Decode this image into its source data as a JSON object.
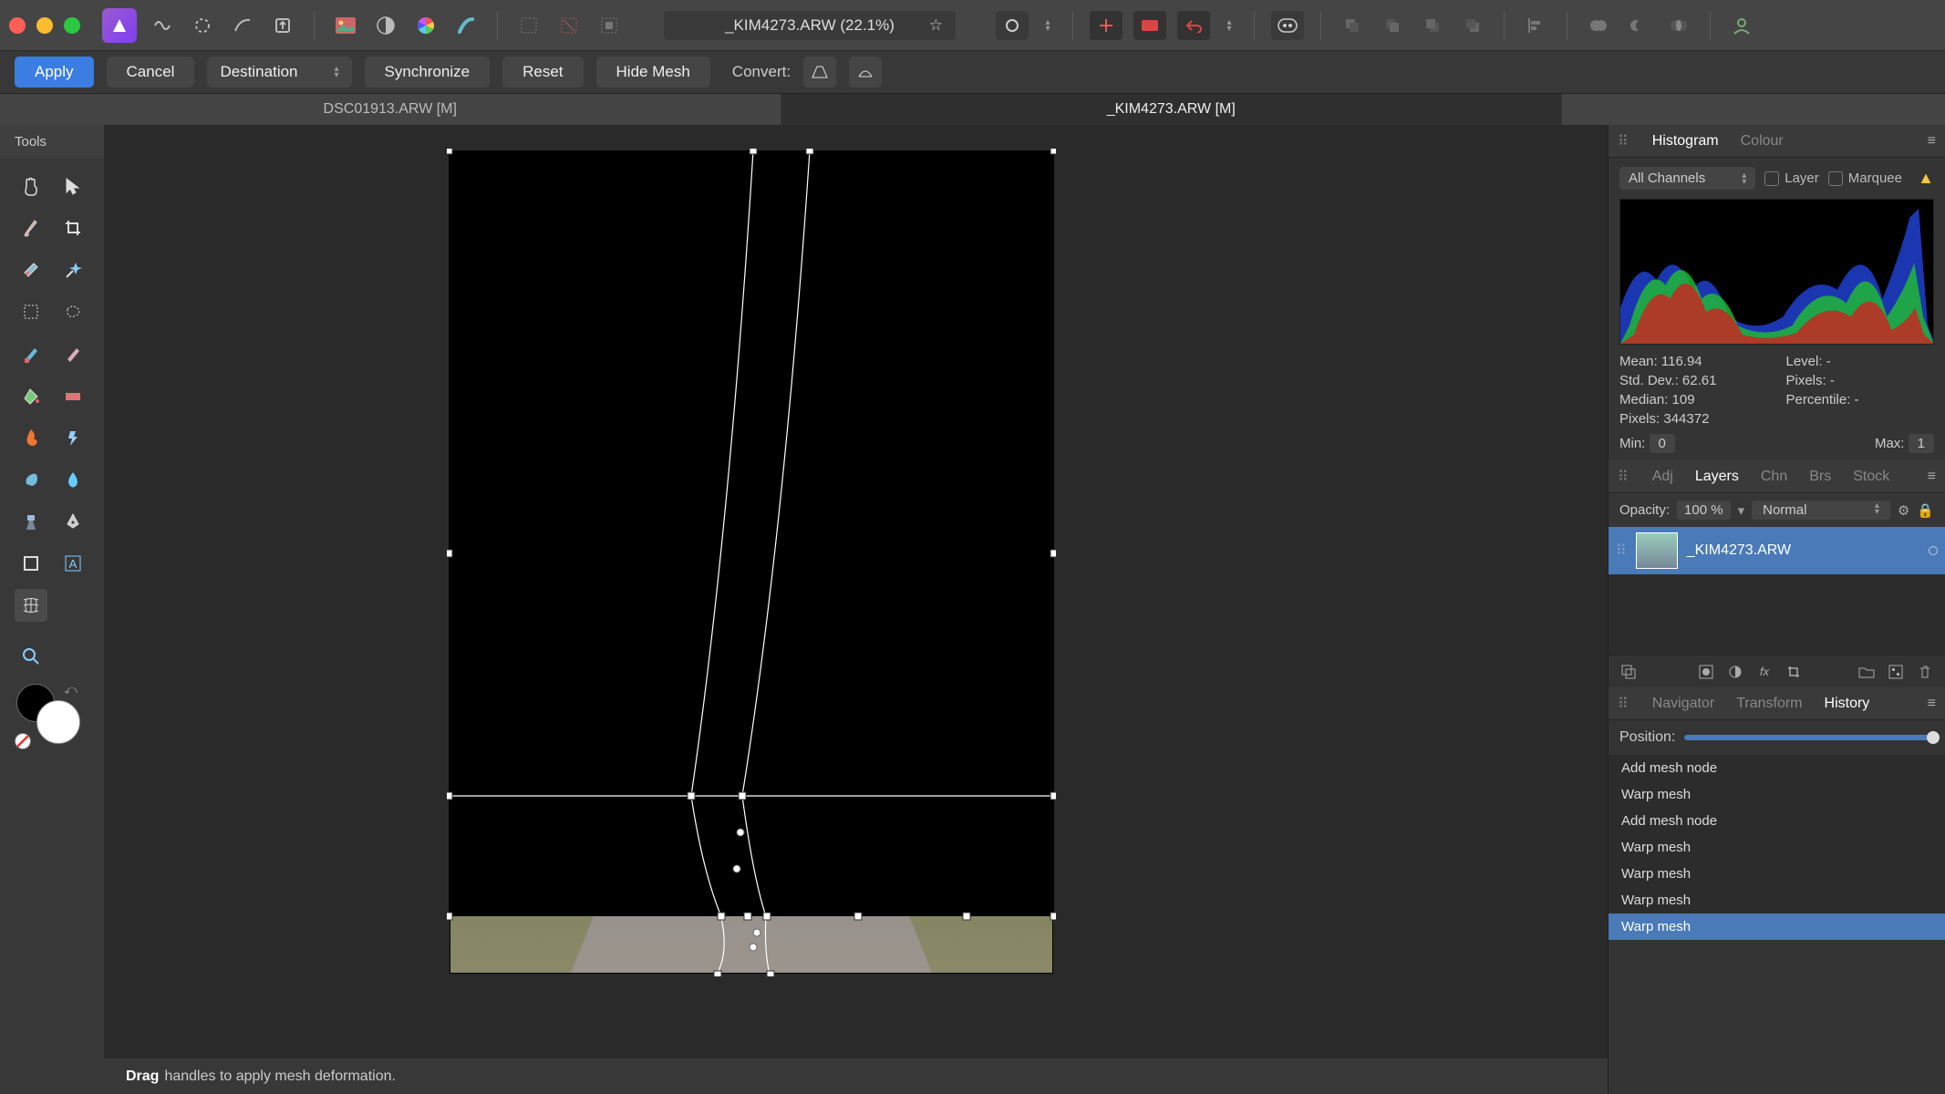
{
  "app": {
    "doc_title": "_KIM4273.ARW (22.1%)"
  },
  "context_bar": {
    "apply": "Apply",
    "cancel": "Cancel",
    "mode_select": "Destination",
    "synchronize": "Synchronize",
    "reset": "Reset",
    "hide_mesh": "Hide Mesh",
    "convert_label": "Convert:"
  },
  "doc_tabs": {
    "t0": "DSC01913.ARW [M]",
    "t1": "_KIM4273.ARW [M]"
  },
  "tools": {
    "title": "Tools"
  },
  "status": {
    "bold": "Drag",
    "rest": "handles to apply mesh deformation."
  },
  "histogram_panel": {
    "tab_hist": "Histogram",
    "tab_colour": "Colour",
    "channels": "All Channels",
    "chk_layer": "Layer",
    "chk_marquee": "Marquee",
    "mean_label": "Mean:",
    "mean_val": "116.94",
    "std_label": "Std. Dev.:",
    "std_val": "62.61",
    "median_label": "Median:",
    "median_val": "109",
    "pixels_label": "Pixels:",
    "pixels_val": "344372",
    "level_label": "Level:",
    "level_val": "-",
    "pixr_label": "Pixels:",
    "pixr_val": "-",
    "perc_label": "Percentile:",
    "perc_val": "-",
    "min_label": "Min:",
    "min_val": "0",
    "max_label": "Max:",
    "max_val": "1"
  },
  "layers_panel": {
    "tab_adj": "Adj",
    "tab_layers": "Layers",
    "tab_chn": "Chn",
    "tab_brs": "Brs",
    "tab_stock": "Stock",
    "opacity_label": "Opacity:",
    "opacity_val": "100 %",
    "blend_mode": "Normal",
    "layer_name": "_KIM4273.ARW"
  },
  "history_panel": {
    "tab_nav": "Navigator",
    "tab_trans": "Transform",
    "tab_hist": "History",
    "pos_label": "Position:",
    "items": {
      "i0": "Add mesh node",
      "i1": "Warp mesh",
      "i2": "Add mesh node",
      "i3": "Warp mesh",
      "i4": "Warp mesh",
      "i5": "Warp mesh",
      "i6": "Warp mesh"
    }
  }
}
